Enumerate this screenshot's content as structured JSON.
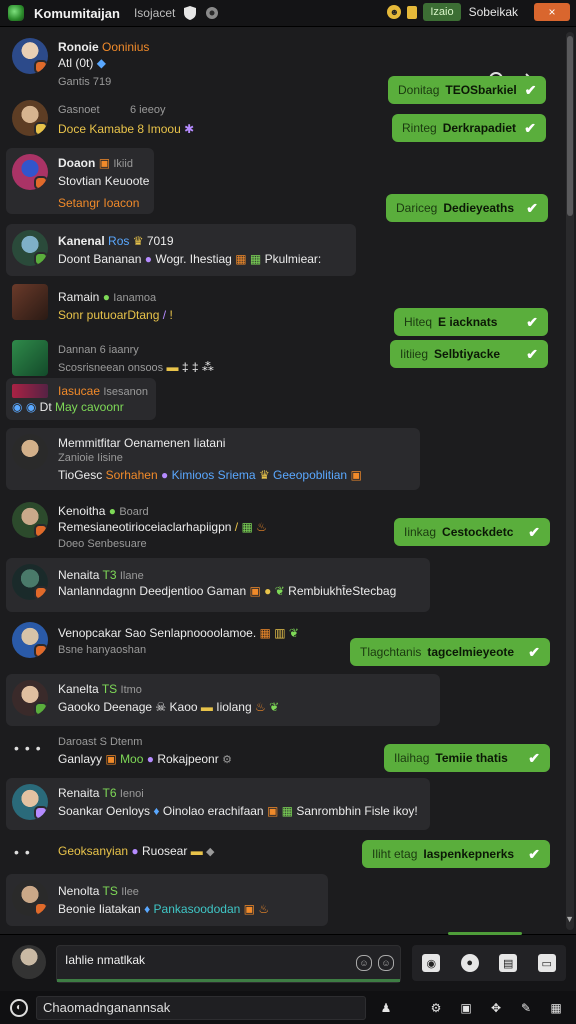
{
  "titlebar": {
    "title": "Komumitaijan",
    "subtitle": "Isojacet",
    "shield_icon": "shield-icon",
    "badge": "Izaio",
    "label": "Sobeikak",
    "close": "×"
  },
  "messages": [
    {
      "name": "Ronoie",
      "tag": "Ooninius",
      "l2": "Atl (0t)",
      "l3": "Gantis 719"
    },
    {
      "name": "Gasnoet",
      "tag": "6 ieeoy",
      "l2": "Doce Kamabe 8 Imoou",
      "l3": ""
    },
    {
      "name": "Doaon",
      "tag": "Ikiid",
      "l2": "Stovtian Keuoote",
      "l3": "Setangr Ioacon"
    },
    {
      "name": "Kanenal",
      "tag": "Ros",
      "tag2": "7019",
      "l2": "Doont Bananan",
      "l2b": "Wogr. Ihestiag",
      "l2c": "Pkulmiear:"
    },
    {
      "name": "Ramain",
      "tag": "Ianamoa",
      "l2": "Sonr putuoarDtang"
    },
    {
      "name": "Dannan",
      "tag": "6 iaanry",
      "l2": "Scosrisneean onsoos"
    },
    {
      "name": "Iasucae",
      "tag": "Isesanon",
      "l2": "Dt",
      "l2b": "May cavoonr"
    },
    {
      "name": "Memmitfitar Oenamenen Iiatani",
      "tag": "Zanioie",
      "tag2": "Iisine",
      "l2": "TioGesc",
      "l2b": "Sorhahen",
      "l2c": "Kimioos Sriema",
      "l2d": "Geeopoblitian"
    },
    {
      "name": "Kenoitha",
      "tag": "Board",
      "l2": "Remesianeotirioceiaclarhapiigpn",
      "l3": "Doeo Senbesuare"
    },
    {
      "name": "Nenaita",
      "tag": "T3",
      "tag2": "Ilane",
      "l2": "Nanlanndagnn Deedjentioo Gaman",
      "l2b": "Rembiukht̄eStecbag"
    },
    {
      "name": "Venopcakar",
      "tag": "Sao Senlapnoooolamoe.",
      "l2": "Bsne hanyaoshan"
    },
    {
      "name": "Kanelta",
      "tag": "TS",
      "tag2": "Itmo",
      "l2": "Gaooko Deenage",
      "l2b": "Kaoo",
      "l2c": "Iiolang"
    },
    {
      "name": "Daroast",
      "tag": "S Dtenm",
      "l2": "Ganlayy",
      "l2b": "Moo",
      "l2c": "Rokajpeonr"
    },
    {
      "name": "Renaita",
      "tag": "T6",
      "tag2": "Ienoi",
      "l2": "Soankar Oenloys",
      "l2b": "Oinolao erachifaan",
      "l2c": "Sanrombhin Fisle ikoy!"
    },
    {
      "name": "Geoksanyian",
      "tag": "Ruosear"
    },
    {
      "name": "Nenolta",
      "tag": "TS",
      "tag2": "Ilee",
      "l2": "Beonie Iiatakan",
      "l2b": "Pankasoododan"
    }
  ],
  "bubbles": [
    {
      "pre": "Donitag",
      "main": "TEOSbarkiel"
    },
    {
      "pre": "Rinteg",
      "main": "Derkrapadiet"
    },
    {
      "pre": "Dariceg",
      "main": "Dedieyeaths"
    },
    {
      "pre": "Hiteq",
      "main": "E iacknats"
    },
    {
      "pre": "Iitiieg",
      "main": "Selbtiyacke"
    },
    {
      "pre": "Iinkag",
      "main": "Cestockdetc"
    },
    {
      "pre": "Tlagchtanis",
      "main": "tagcelmieyeote"
    },
    {
      "pre": "Ilaihag",
      "main": "Temiie thatis"
    },
    {
      "pre": "Iliht etag",
      "main": "Iaspenkepnerks"
    }
  ],
  "composer": {
    "text": "Iahlie nmatlkak"
  },
  "bottombar": {
    "search": "Chaomadnganannsak"
  }
}
